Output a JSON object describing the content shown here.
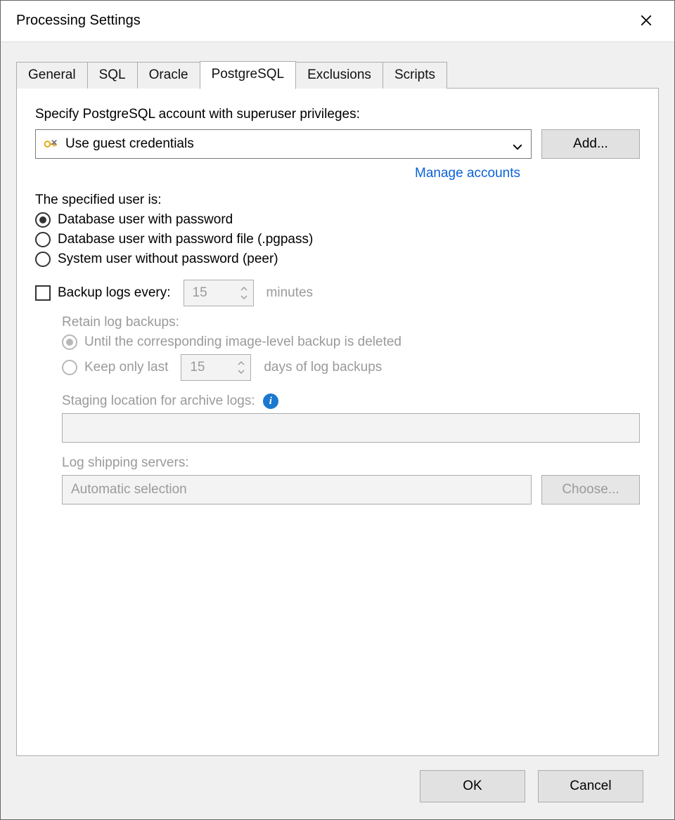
{
  "title": "Processing Settings",
  "tabs": {
    "general": "General",
    "sql": "SQL",
    "oracle": "Oracle",
    "postgresql": "PostgreSQL",
    "exclusions": "Exclusions",
    "scripts": "Scripts"
  },
  "panel": {
    "specify_label": "Specify PostgreSQL account with superuser privileges:",
    "credentials_value": "Use guest credentials",
    "add_button": "Add...",
    "manage_link": "Manage accounts",
    "user_is_label": "The specified user is:",
    "radio_db_password": "Database user with password",
    "radio_db_pgpass": "Database user with password file (.pgpass)",
    "radio_system_peer": "System user without password (peer)",
    "backup_logs_label": "Backup logs every:",
    "backup_logs_value": "15",
    "backup_logs_unit": "minutes",
    "retain_label": "Retain log backups:",
    "retain_until": "Until the corresponding image-level backup is deleted",
    "retain_keep_prefix": "Keep only last",
    "retain_keep_value": "15",
    "retain_keep_suffix": "days of log backups",
    "staging_label": "Staging location for archive logs:",
    "staging_value": "",
    "logship_label": "Log shipping servers:",
    "logship_value": "Automatic selection",
    "choose_button": "Choose..."
  },
  "footer": {
    "ok": "OK",
    "cancel": "Cancel"
  }
}
